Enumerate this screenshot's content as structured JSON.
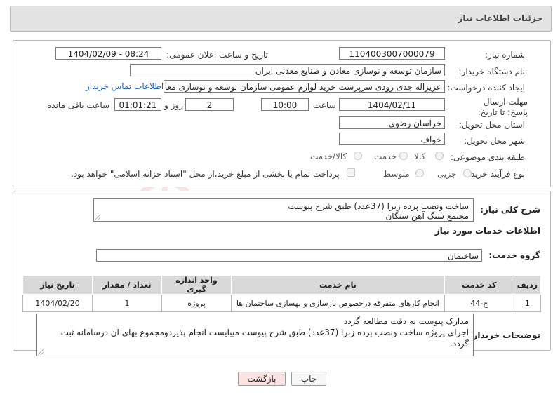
{
  "header": {
    "title": "جزئیات اطلاعات نیاز"
  },
  "form": {
    "need_number_label": "شماره نیاز:",
    "need_number": "1104003007000079",
    "announce_label": "تاریخ و ساعت اعلان عمومی:",
    "announce_value": "1404/02/09 - 08:24",
    "buyer_org_label": "نام دستگاه خریدار:",
    "buyer_org": "سازمان توسعه و نوسازی معادن و صنایع معدنی ایران",
    "creator_label": "ایجاد کننده درخواست:",
    "creator": "عزیزاله جدی رودی سرپرست خرید لوازم عمومی  سازمان توسعه و نوسازی معادن و صنایع معدنی ایران",
    "contact_link": "اطلاعات تماس خریدار",
    "deadline_label": "مهلت ارسال پاسخ: تا تاریخ:",
    "deadline_date": "1404/02/11",
    "time_label": "ساعت",
    "deadline_time": "10:00",
    "days_value": "2",
    "days_label": "روز و",
    "remaining_time": "01:01:21",
    "remaining_label": "ساعت باقی مانده",
    "province_label": "استان محل تحویل:",
    "province": "خراسان رضوی",
    "city_label": "شهر محل تحویل:",
    "city": "خواف",
    "category_label": "طبقه بندی موضوعی:",
    "category_options": [
      "کالا",
      "خدمت",
      "کالا/خدمت"
    ],
    "process_label": "نوع فرآیند خرید :",
    "process_options": [
      "جزیی",
      "متوسط"
    ],
    "treasury_note": "پرداخت تمام یا بخشی از مبلغ خرید،از محل \"اسناد خزانه اسلامی\" خواهد بود."
  },
  "summary": {
    "label": "شرح کلی نیاز:",
    "line1": "ساخت ونصب پرده زبرا (37عدد) طبق شرح پیوست",
    "line2": "مجتمع سنگ آهن سنگان"
  },
  "services": {
    "title": "اطلاعات خدمات مورد نیاز",
    "group_label": "گروه خدمت:",
    "group_value": "ساختمان",
    "columns": [
      "ردیف",
      "کد خدمت",
      "نام خدمت",
      "واحد اندازه گیری",
      "تعداد / مقدار",
      "تاریخ نیاز"
    ],
    "rows": [
      [
        "1",
        "ج-44",
        "انجام کارهای متفرقه درخصوص بازسازی و بهسازی ساختمان ها",
        "پروژه",
        "1",
        "1404/02/20"
      ]
    ]
  },
  "notes": {
    "label": "توضیحات خریدار:",
    "line1": "مدارک پیوست به دقت مطالعه گردد",
    "line2": "اجرای پروژه ساخت ونصب پرده زبرا (37عدد) طبق شرح پیوست میبایست انجام پذیردومجموع بهای آن درسامانه ثبت گردد."
  },
  "buttons": {
    "print": "چاپ",
    "back": "بازگشت"
  },
  "watermark": {
    "text": "AriaTender.neT"
  },
  "colors": {
    "link": "#1a5fb4",
    "back_button_bg": "#fbe3e3",
    "header_bg": "#e3e3e3"
  }
}
